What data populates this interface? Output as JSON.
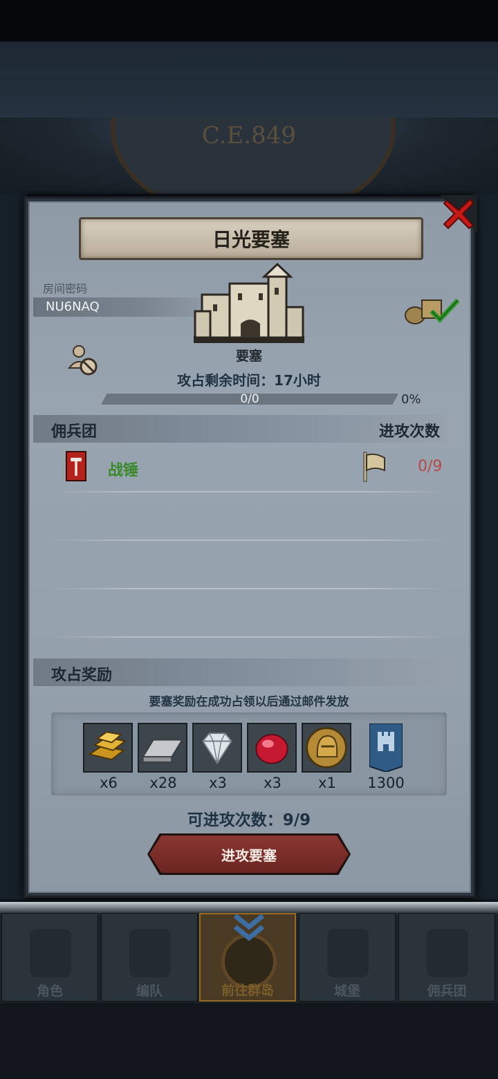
{
  "background": {
    "year": "C.E.849"
  },
  "dialog": {
    "title": "日光要塞",
    "room_label": "房间密码",
    "room_code": "NU6NAQ",
    "building_label": "要塞",
    "timer": "攻占剩余时间：17小时",
    "progress": {
      "text": "0/0",
      "percent_label": "0%",
      "fraction": 0.0
    },
    "mercenary_section": {
      "title": "佣兵团",
      "attack_count_header": "进攻次数"
    },
    "mercenaries": [
      {
        "name": "战锤",
        "attacks": "0/9",
        "icon": "hammer-banner-icon"
      }
    ],
    "rewards_section": {
      "title": "攻占奖励",
      "note": "要塞奖励在成功占领以后通过邮件发放"
    },
    "rewards": [
      {
        "icon": "gold-bar-icon",
        "count": "x6"
      },
      {
        "icon": "silver-bar-icon",
        "count": "x28"
      },
      {
        "icon": "diamond-icon",
        "count": "x3"
      },
      {
        "icon": "ruby-icon",
        "count": "x3"
      },
      {
        "icon": "knight-medal-icon",
        "count": "x1"
      },
      {
        "icon": "castle-banner-icon",
        "count": "1300"
      }
    ],
    "attacks_left": "可进攻次数：9/9",
    "attack_button": "进攻要塞"
  },
  "nav": {
    "items": [
      {
        "label": "角色",
        "active": false
      },
      {
        "label": "编队",
        "active": false
      },
      {
        "label": "前往群岛",
        "active": true
      },
      {
        "label": "城堡",
        "active": false
      },
      {
        "label": "佣兵团",
        "active": false
      }
    ]
  },
  "colors": {
    "accent_button": "#7a2c28",
    "mercenary_name": "#3a8a2a",
    "attack_count": "#b74a48"
  }
}
